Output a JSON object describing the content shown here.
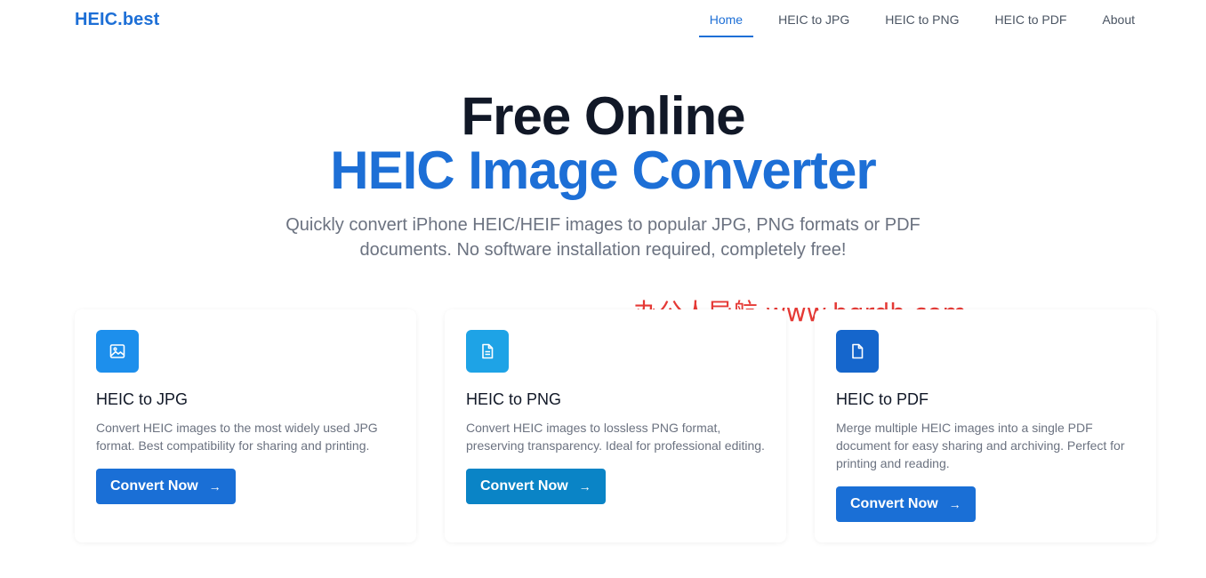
{
  "nav": {
    "logo": "HEIC.best",
    "items": [
      {
        "label": "Home"
      },
      {
        "label": "HEIC to JPG"
      },
      {
        "label": "HEIC to PNG"
      },
      {
        "label": "HEIC to PDF"
      },
      {
        "label": "About"
      }
    ],
    "active": "Home",
    "accent_color": "#1d6fd6"
  },
  "hero": {
    "title_line1": "Free Online",
    "title_line2": "HEIC Image Converter",
    "subtitle": "Quickly convert iPhone HEIC/HEIF images to popular JPG, PNG formats or PDF documents. No software installation required, completely free!"
  },
  "watermark": "办公人导航  www.bgrdh.com",
  "cards": [
    {
      "icon": "image-icon",
      "icon_color": "#1d8fec",
      "title": "HEIC to JPG",
      "description": "Convert HEIC images to the most widely used JPG format. Best compatibility for sharing and printing.",
      "button_label": "Convert Now",
      "button_color": "#1a6fd6"
    },
    {
      "icon": "document-text-icon",
      "icon_color": "#1ea3e6",
      "title": "HEIC to PNG",
      "description": "Convert HEIC images to lossless PNG format, preserving transparency. Ideal for professional editing.",
      "button_label": "Convert Now",
      "button_color": "#0a84c6"
    },
    {
      "icon": "document-icon",
      "icon_color": "#1566cc",
      "title": "HEIC to PDF",
      "description": "Merge multiple HEIC images into a single PDF document for easy sharing and archiving. Perfect for printing and reading.",
      "button_label": "Convert Now",
      "button_color": "#1a6fd6"
    }
  ]
}
